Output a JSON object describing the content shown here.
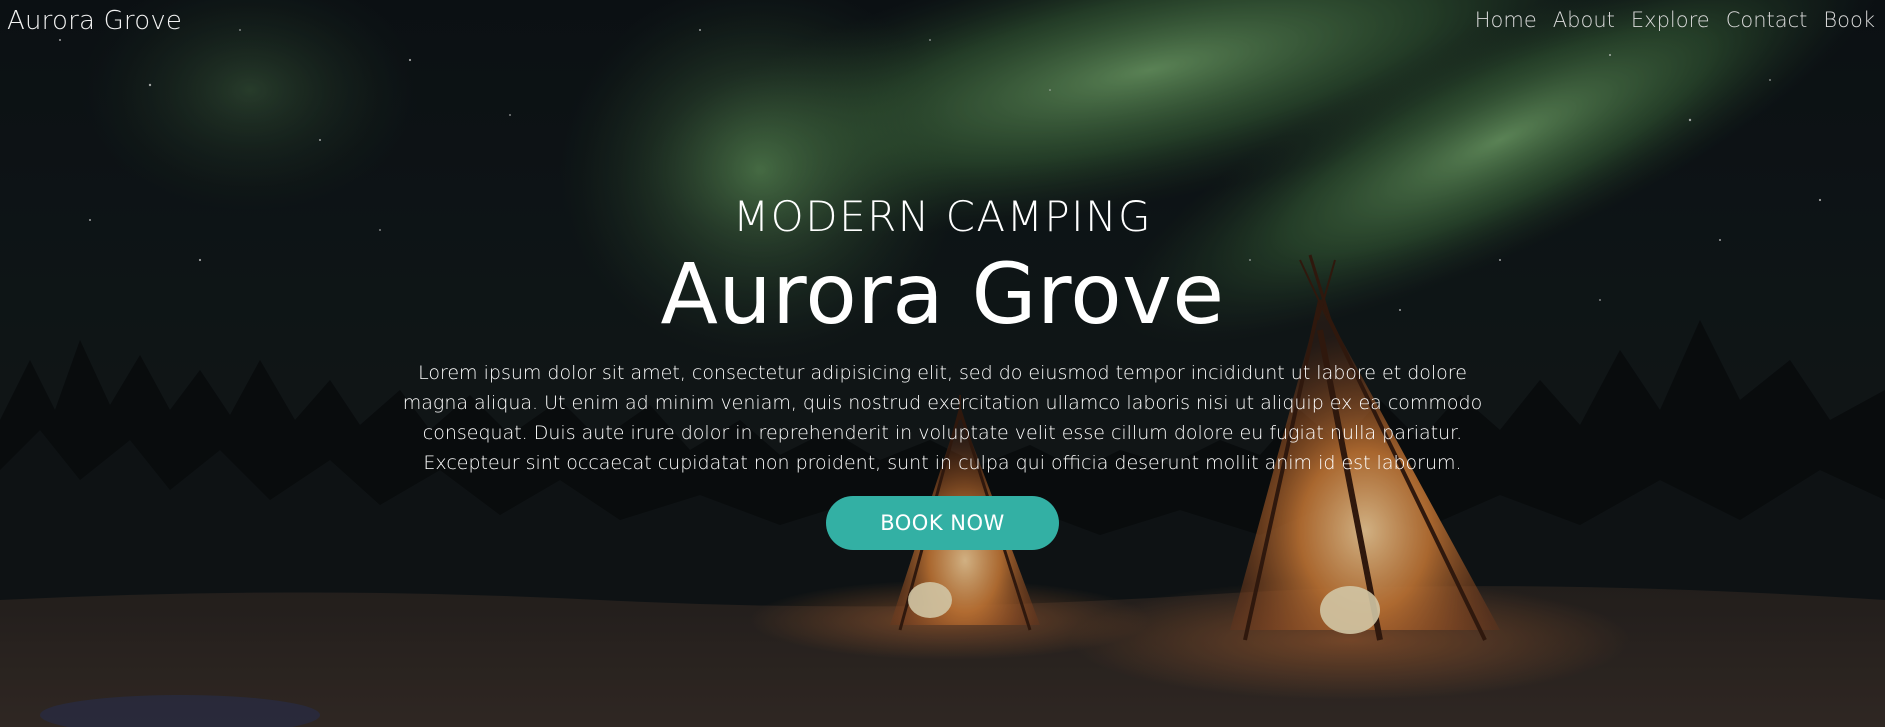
{
  "site": {
    "brand": "Aurora Grove"
  },
  "nav": {
    "items": [
      {
        "label": "Home"
      },
      {
        "label": "About"
      },
      {
        "label": "Explore"
      },
      {
        "label": "Contact"
      },
      {
        "label": "Book"
      }
    ]
  },
  "hero": {
    "eyebrow": "MODERN CAMPING",
    "headline": "Aurora Grove",
    "lede": "Lorem ipsum dolor sit amet, consectetur adipisicing elit, sed do eiusmod tempor incididunt ut labore et dolore magna aliqua. Ut enim ad minim veniam, quis nostrud exercitation ullamco laboris nisi ut aliquip ex ea commodo consequat. Duis aute irure dolor in reprehenderit in voluptate velit esse cillum dolore eu fugiat nulla pariatur. Excepteur sint occaecat cupidatat non proident, sunt in culpa qui officia deserunt mollit anim id est laborum.",
    "cta_label": "BOOK NOW"
  },
  "colors": {
    "accent": "#33b0a4",
    "aurora": "#6fa865",
    "tent_glow": "#f2a35c"
  }
}
